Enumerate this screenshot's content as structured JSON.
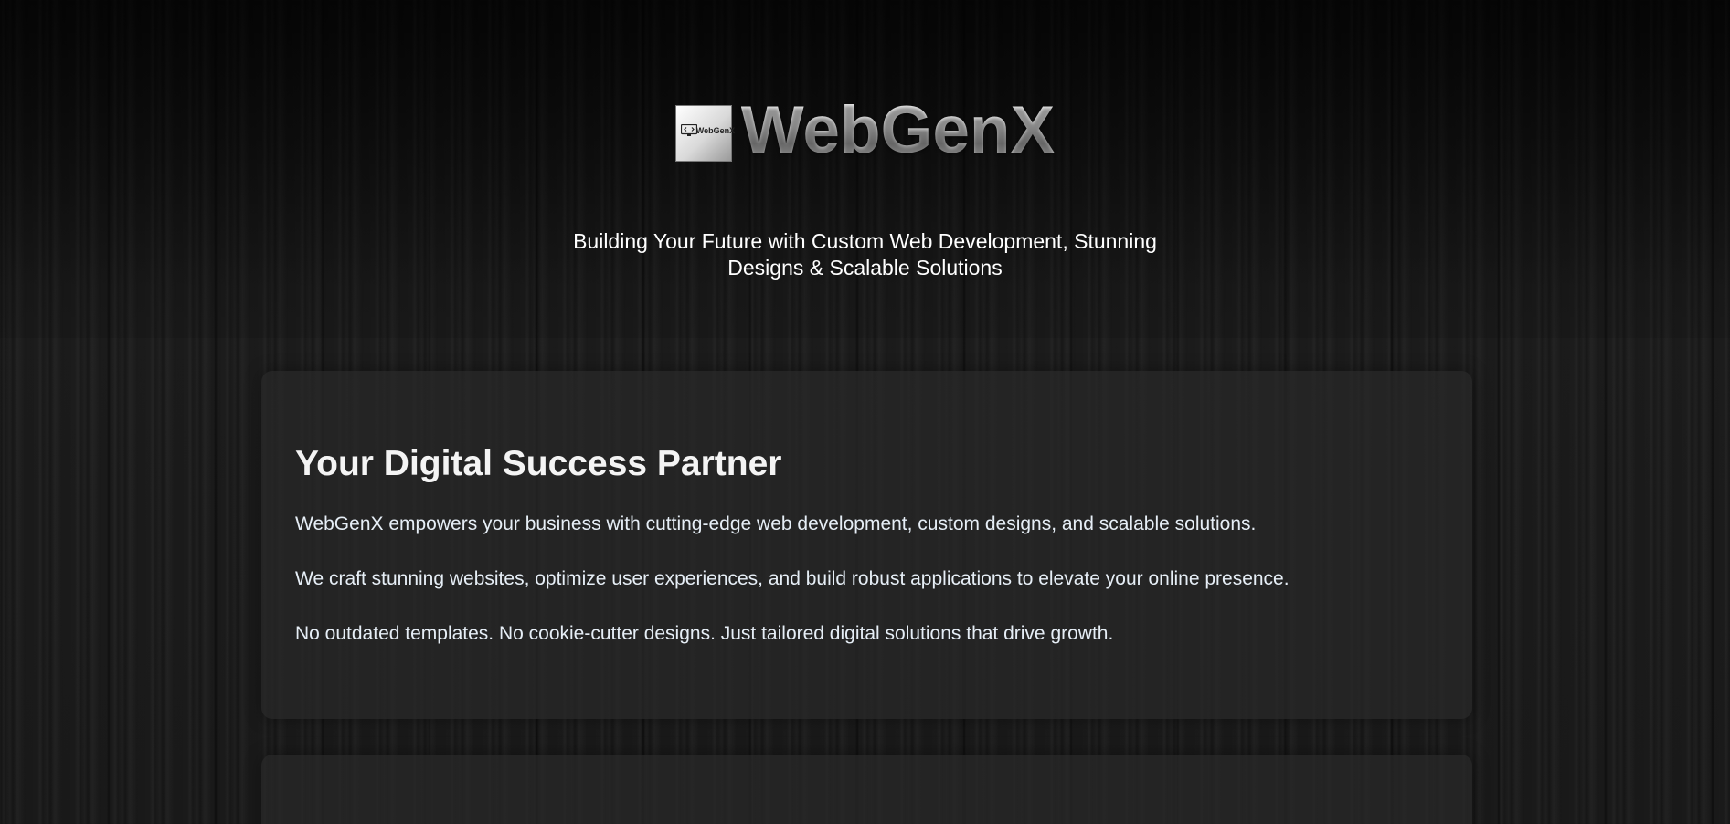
{
  "header": {
    "brand_name": "WebGenX",
    "logo_text": "WebGenX",
    "tagline_line1": "Building Your Future with Custom Web Development, Stunning",
    "tagline_line2": "Designs & Scalable Solutions"
  },
  "main": {
    "sections": [
      {
        "title": "Your Digital Success Partner",
        "paragraphs": [
          "WebGenX empowers your business with cutting-edge web development, custom designs, and scalable solutions.",
          "We craft stunning websites, optimize user experiences, and build robust applications to elevate your online presence.",
          "No outdated templates. No cookie-cutter designs. Just tailored digital solutions that drive growth."
        ]
      }
    ]
  },
  "colors": {
    "background": "#131313",
    "card_background": "#282828",
    "text_primary": "#ffffff",
    "text_body": "#e6eef6",
    "brand_silver": "#cfcfcf"
  },
  "icons": {
    "logo": "monitor-code-icon"
  }
}
